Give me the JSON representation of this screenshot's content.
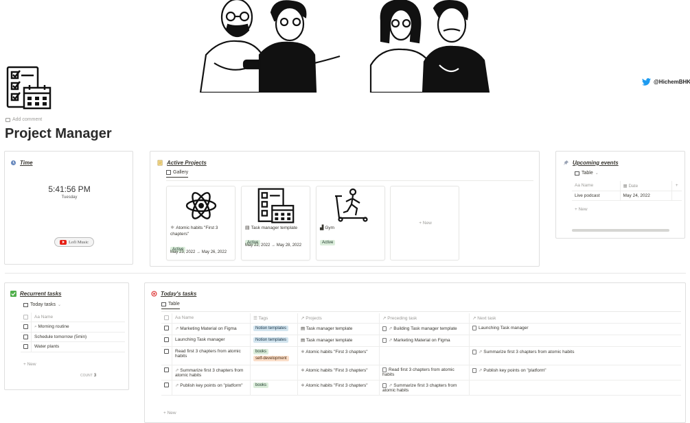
{
  "twitter": {
    "handle": "@HichemBHKA",
    "color": "#1d9bf0"
  },
  "page": {
    "add_comment": "Add comment",
    "title": "Project Manager"
  },
  "time_widget": {
    "title": "Time",
    "clock": "5:41:56 PM",
    "day": "Tuesday",
    "music_button": "Lofi Music"
  },
  "active_projects": {
    "title": "Active Projects",
    "view": "Gallery",
    "new_label": "+ New",
    "cards": [
      {
        "icon": "atom-icon",
        "title": "Atomic habits \"First 3 chapters\"",
        "status": "Active",
        "dates": "May 23, 2022 → May 26, 2022"
      },
      {
        "icon": "checklist-calendar-icon",
        "title": "Task manager template",
        "status": "Active",
        "dates": "May 22, 2022 → May 28, 2022"
      },
      {
        "icon": "treadmill-icon",
        "title": "Gym",
        "status": "Active",
        "dates": ""
      }
    ]
  },
  "upcoming": {
    "title": "Upcoming events",
    "view": "Table",
    "columns": [
      "Name",
      "Date"
    ],
    "rows": [
      {
        "name": "Live podcast",
        "date": "May 24, 2022"
      }
    ],
    "new_label": "+ New"
  },
  "recurrent": {
    "title": "Recurrent tasks",
    "view": "Today tasks",
    "column": "Name",
    "items": [
      "Morning routine",
      "Schedule tomorrow (5min)",
      "Water plants"
    ],
    "new_label": "+ New",
    "count_label": "COUNT",
    "count_value": "3"
  },
  "today": {
    "title": "Today's tasks",
    "view": "Table",
    "columns": [
      "Name",
      "Tags",
      "Projects",
      "Preceding task",
      "Next task"
    ],
    "rows": [
      {
        "name": "Marketing Material on Figma",
        "tags": [
          {
            "t": "Notion templates",
            "c": "blue"
          }
        ],
        "projects": "Task manager template",
        "preceding": "Building Task manager template",
        "next": "Launching Task manager"
      },
      {
        "name": "Launching Task manager",
        "tags": [
          {
            "t": "Notion templates",
            "c": "blue"
          }
        ],
        "projects": "Task manager template",
        "preceding": "Marketing Material on Figma",
        "next": ""
      },
      {
        "name": "Read first 3 chapters from atomic habits",
        "tags": [
          {
            "t": "books",
            "c": "green"
          },
          {
            "t": "self-development",
            "c": "orange"
          }
        ],
        "projects": "Atomic habits \"First 3 chapters\"",
        "preceding": "",
        "next": "Summarize first 3 chapters from atomic habits"
      },
      {
        "name": "Summarize first 3 chapters from atomic habits",
        "tags": [],
        "projects": "Atomic habits \"First 3 chapters\"",
        "preceding": "Read first 3 chapters from atomic habits",
        "next": "Publish key points on \"platform\""
      },
      {
        "name": "Publish key points on \"platform\"",
        "tags": [
          {
            "t": "books",
            "c": "green"
          }
        ],
        "projects": "Atomic habits \"First 3 chapters\"",
        "preceding": "Summarize first 3 chapters from atomic habits",
        "next": ""
      }
    ],
    "new_label": "+ New"
  }
}
